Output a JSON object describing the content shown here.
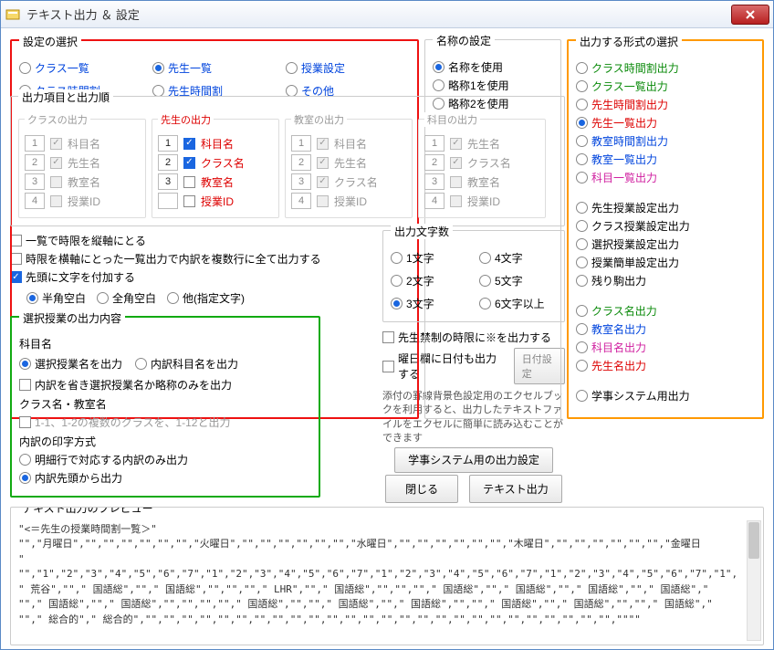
{
  "window_title": "テキスト出力 ＆ 設定",
  "groups": {
    "select": {
      "legend": "設定の選択",
      "items": [
        "クラス一覧",
        "先生一覧",
        "授業設定",
        "クラス時間割",
        "先生時間割",
        "その他"
      ],
      "selected": 1
    },
    "naming": {
      "legend": "名称の設定",
      "items": [
        "名称を使用",
        "略称1を使用",
        "略称2を使用"
      ],
      "selected": 0
    },
    "format": {
      "legend": "出力する形式の選択",
      "items_a": [
        {
          "label": "クラス時間割出力",
          "cls": "txt-green"
        },
        {
          "label": "クラス一覧出力",
          "cls": "txt-green"
        },
        {
          "label": "先生時間割出力",
          "cls": "txt-red"
        },
        {
          "label": "先生一覧出力",
          "cls": "txt-red",
          "checked": true
        },
        {
          "label": "教室時間割出力",
          "cls": "txt-blue"
        },
        {
          "label": "教室一覧出力",
          "cls": "txt-blue"
        },
        {
          "label": "科目一覧出力",
          "cls": "txt-magenta"
        }
      ],
      "items_b": [
        "先生授業設定出力",
        "クラス授業設定出力",
        "選択授業設定出力",
        "授業簡単設定出力",
        "残り駒出力"
      ],
      "items_c": [
        {
          "label": "クラス名出力",
          "cls": "txt-green"
        },
        {
          "label": "教室名出力",
          "cls": "txt-blue"
        },
        {
          "label": "科目名出力",
          "cls": "txt-magenta"
        },
        {
          "label": "先生名出力",
          "cls": "txt-red"
        }
      ],
      "items_d": [
        "学事システム用出力"
      ]
    },
    "out_items": {
      "legend": "出力項目と出力順",
      "cols": [
        {
          "title": "クラスの出力",
          "cls": "txt-gray",
          "disabled": true,
          "rows": [
            {
              "n": "1",
              "label": "科目名",
              "chk": true
            },
            {
              "n": "2",
              "label": "先生名",
              "chk": true
            },
            {
              "n": "3",
              "label": "教室名",
              "chk": false
            },
            {
              "n": "4",
              "label": "授業ID",
              "chk": false
            }
          ]
        },
        {
          "title": "先生の出力",
          "cls": "txt-red",
          "disabled": false,
          "rows": [
            {
              "n": "1",
              "label": "科目名",
              "chk": true,
              "lcl": "txt-red"
            },
            {
              "n": "2",
              "label": "クラス名",
              "chk": true,
              "lcl": "txt-red"
            },
            {
              "n": "3",
              "label": "教室名",
              "chk": false,
              "lcl": "txt-red"
            },
            {
              "n": "",
              "label": "授業ID",
              "chk": false,
              "lcl": "txt-red"
            }
          ]
        },
        {
          "title": "教室の出力",
          "cls": "txt-gray",
          "disabled": true,
          "rows": [
            {
              "n": "1",
              "label": "科目名",
              "chk": true
            },
            {
              "n": "2",
              "label": "先生名",
              "chk": true
            },
            {
              "n": "3",
              "label": "クラス名",
              "chk": true
            },
            {
              "n": "4",
              "label": "授業ID",
              "chk": false
            }
          ]
        },
        {
          "title": "科目の出力",
          "cls": "txt-gray",
          "disabled": true,
          "rows": [
            {
              "n": "1",
              "label": "先生名",
              "chk": true
            },
            {
              "n": "2",
              "label": "クラス名",
              "chk": true
            },
            {
              "n": "3",
              "label": "教室名",
              "chk": false
            },
            {
              "n": "4",
              "label": "授業ID",
              "chk": false
            }
          ]
        }
      ]
    }
  },
  "checks": {
    "c1": "一覧で時限を縦軸にとる",
    "c2": "時限を横軸にとった一覧出力で内訳を複数行に全て出力する",
    "c3": "先頭に文字を付加する",
    "c3_opts": [
      "半角空白",
      "全角空白",
      "他(指定文字)"
    ],
    "c3_sel": 0,
    "c5": "先生禁制の時限に※を出力する",
    "c6": "曜日欄に日付も出力する",
    "date_btn": "日付設定"
  },
  "char_count": {
    "legend": "出力文字数",
    "items": [
      "1文字",
      "2文字",
      "3文字",
      "4文字",
      "5文字",
      "6文字以上"
    ],
    "selected": 2
  },
  "sel_output": {
    "legend": "選択授業の出力内容",
    "sec1": "科目名",
    "r1": [
      "選択授業名を出力",
      "内訳科目名を出力"
    ],
    "r1_sel": 0,
    "c": "内訳を省き選択授業名か略称のみを出力",
    "sec2": "クラス名・教室名",
    "hint": "1-1、1-2の複数のクラスを、1-12と出力",
    "sec3": "内訳の印字方式",
    "r2": [
      "明細行で対応する内訳のみ出力",
      "内訳先頭から出力"
    ],
    "r2_sel": 1
  },
  "excel_note": "添付の罫線背景色設定用のエクセルブックを利用すると、出力したテキストファイルをエクセルに簡単に読み込むことができます",
  "btn_excel": "学事システム用の出力設定",
  "btn_close": "閉じる",
  "btn_output": "テキスト出力",
  "preview": {
    "legend": "テキスト出力のプレビュー",
    "lines": [
      "\"<＝先生の授業時間割一覧＞\"",
      "\"\",\"月曜日\",\"\",\"\",\"\",\"\",\"\",\"\",\"火曜日\",\"\",\"\",\"\",\"\",\"\",\"\",\"水曜日\",\"\",\"\",\"\",\"\",\"\",\"\",\"木曜日\",\"\",\"\",\"\",\"\",\"\",\"\",\"金曜日",
      "\"",
      "\"\",\"1\",\"2\",\"3\",\"4\",\"5\",\"6\",\"7\",\"1\",\"2\",\"3\",\"4\",\"5\",\"6\",\"7\",\"1\",\"2\",\"3\",\"4\",\"5\",\"6\",\"7\",\"1\",\"2\",\"3\",\"4\",\"5\",\"6\",\"7\",\"1\",",
      "\" 荒谷\",\"\",\" 国語総\",\"\",\" 国語総\",\"\",\"\",\"\",\" LHR\",\"\",\" 国語総\",\"\",\"\",\"\",\" 国語総\",\"\",\" 国語総\",\"\",\" 国語総\",\"\",\" 国語総\",\"",
      "\"\",\" 国語総\",\"\",\" 国語総\",\"\",\"\",\"\",\"\",\" 国語総\",\"\",\"\",\" 国語総\",\"\",\" 国語総\",\"\",\"\",\" 国語総\",\"\",\" 国語総\",\"\",\"\",\" 国語総\",\"",
      "\"\",\" 総合的\",\" 総合的\",\"\",\"\",\"\",\"\",\"\",\"\",\"\",\"\",\"\",\"\",\"\",\"\",\"\",\"\",\"\",\"\",\"\",\"\",\"\",\"\",\"\",\"\",\"\",\"\",\"\",\"\",\"\"\"\""
    ]
  }
}
